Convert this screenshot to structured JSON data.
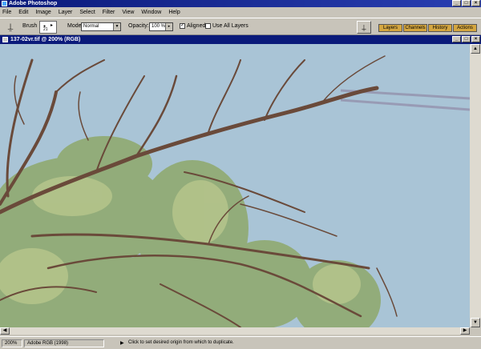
{
  "app": {
    "title": "Adobe Photoshop"
  },
  "menu": [
    "File",
    "Edit",
    "Image",
    "Layer",
    "Select",
    "Filter",
    "View",
    "Window",
    "Help"
  ],
  "options": {
    "brush_label": "Brush",
    "brush_size": "21",
    "mode_label": "Mode:",
    "mode_value": "Normal",
    "opacity_label": "Opacity:",
    "opacity_value": "100 %",
    "aligned_label": "Aligned",
    "aligned_checked": true,
    "use_all_layers_label": "Use All Layers",
    "use_all_layers_checked": false
  },
  "palettes": [
    "Layers",
    "Channels",
    "History",
    "Actions"
  ],
  "document": {
    "title": "137-02vr.tif @ 200% (RGB)"
  },
  "status": {
    "zoom": "200%",
    "profile": "Adobe RGB (1998)",
    "message": "Click to set desired origin from which to duplicate."
  },
  "icons": {
    "tool": "clone-stamp-icon",
    "palette_button": "clone-stamp-icon"
  },
  "colors": {
    "title_bar": "#0a1a7a",
    "palette_tab": "#d4a640",
    "sky": "#a9c4d6",
    "branch": "#6a4a3a",
    "foliage": "#8fa86a"
  }
}
